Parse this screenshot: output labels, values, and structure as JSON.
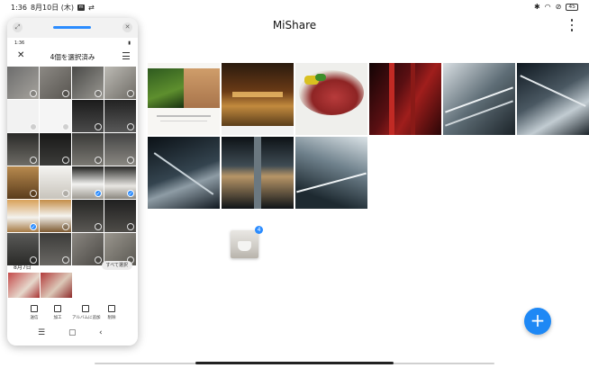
{
  "status_bar": {
    "time": "1:36",
    "date": "8月10日 (木)",
    "battery": "45"
  },
  "header": {
    "title": "MiShare"
  },
  "drag": {
    "count": "4"
  },
  "phone": {
    "status_time": "1:36",
    "toolbar_title": "4個を選択済み",
    "section_date": "8月7日",
    "select_all": "すべて選択",
    "actions": [
      {
        "label": "送信",
        "icon": "share-icon"
      },
      {
        "label": "加工",
        "icon": "edit-icon"
      },
      {
        "label": "アルバムに追加",
        "icon": "album-add-icon"
      },
      {
        "label": "削除",
        "icon": "trash-icon"
      }
    ]
  },
  "colors": {
    "accent": "#1e88f5",
    "check": "#2b8cff"
  }
}
